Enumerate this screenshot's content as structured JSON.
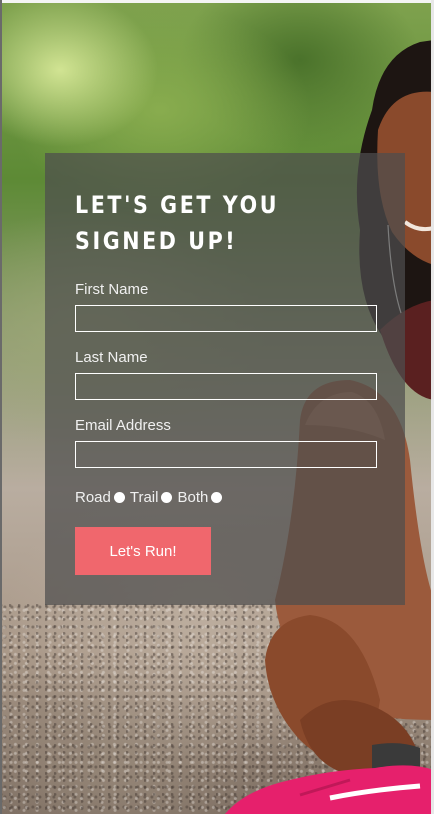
{
  "form": {
    "title": "LET'S GET YOU SIGNED UP!",
    "fields": [
      {
        "label": "First Name",
        "value": ""
      },
      {
        "label": "Last Name",
        "value": ""
      },
      {
        "label": "Email Address",
        "value": ""
      }
    ],
    "run_types": [
      {
        "label": "Road"
      },
      {
        "label": "Trail"
      },
      {
        "label": "Both"
      }
    ],
    "submit_label": "Let's Run!"
  },
  "colors": {
    "card_background": "#4e4e4e",
    "button": "#f0676d",
    "text": "#ffffff"
  }
}
